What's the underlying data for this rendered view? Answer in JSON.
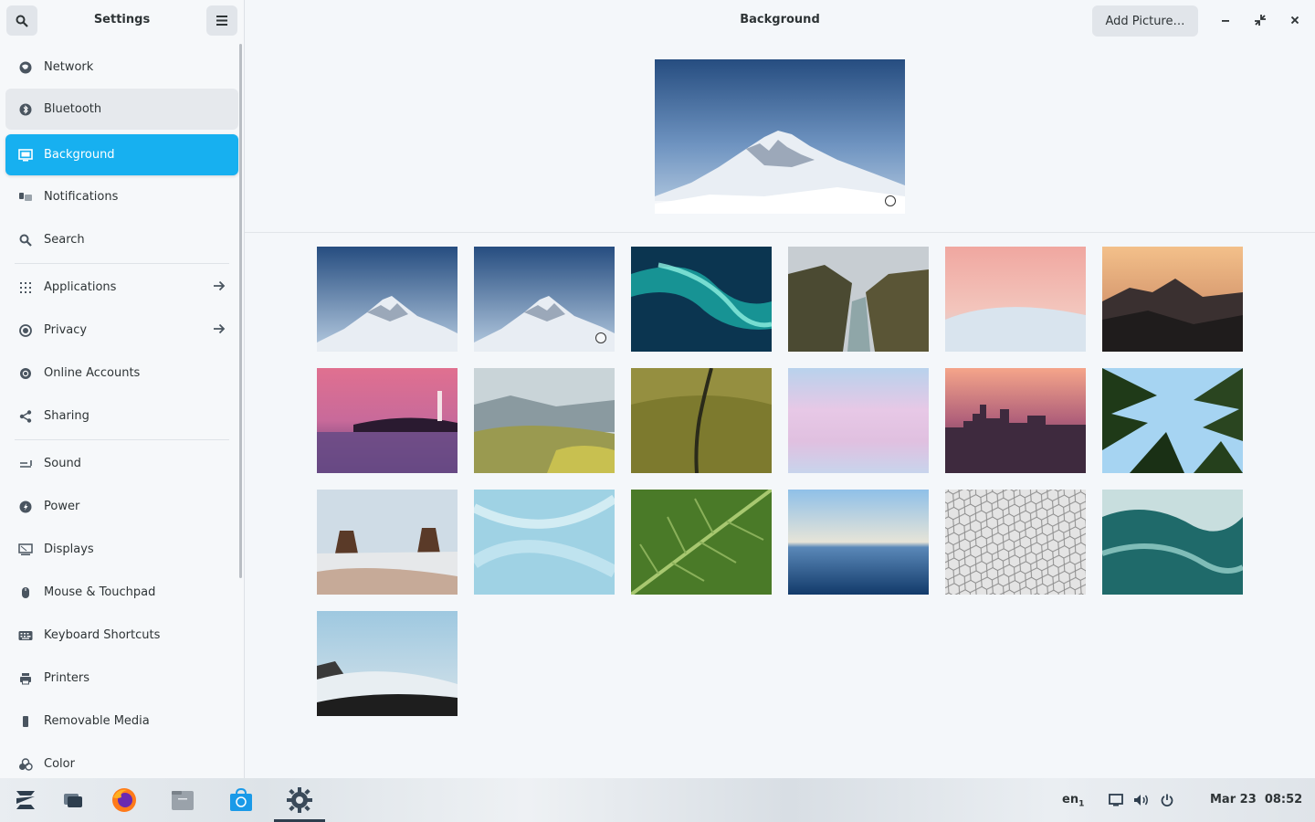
{
  "sidebar": {
    "title": "Settings",
    "items": [
      {
        "label": "Network",
        "icon": "network-icon"
      },
      {
        "label": "Bluetooth",
        "icon": "bluetooth-icon"
      },
      {
        "label": "Background",
        "icon": "background-icon"
      },
      {
        "label": "Notifications",
        "icon": "notifications-icon"
      },
      {
        "label": "Search",
        "icon": "search-icon"
      },
      {
        "label": "Applications",
        "icon": "applications-icon"
      },
      {
        "label": "Privacy",
        "icon": "privacy-icon"
      },
      {
        "label": "Online Accounts",
        "icon": "online-accounts-icon"
      },
      {
        "label": "Sharing",
        "icon": "sharing-icon"
      },
      {
        "label": "Sound",
        "icon": "sound-icon"
      },
      {
        "label": "Power",
        "icon": "power-icon"
      },
      {
        "label": "Displays",
        "icon": "displays-icon"
      },
      {
        "label": "Mouse & Touchpad",
        "icon": "mouse-icon"
      },
      {
        "label": "Keyboard Shortcuts",
        "icon": "keyboard-icon"
      },
      {
        "label": "Printers",
        "icon": "printer-icon"
      },
      {
        "label": "Removable Media",
        "icon": "removable-media-icon"
      },
      {
        "label": "Color",
        "icon": "color-icon"
      }
    ],
    "selected": "Background"
  },
  "main": {
    "title": "Background",
    "add_button": "Add Picture…"
  },
  "taskbar": {
    "language": "en",
    "language_sub": "1",
    "date": "Mar 23",
    "time": "08:52"
  },
  "colors": {
    "accent": "#17b0f0",
    "sidebar_bg": "#f6f8fa",
    "main_bg": "#f4f7fa"
  }
}
